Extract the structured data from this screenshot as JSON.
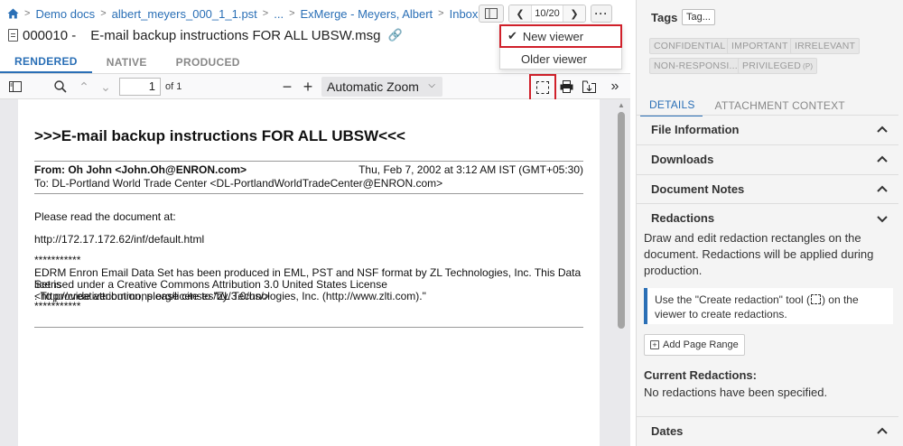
{
  "breadcrumb": {
    "items": [
      "Demo docs",
      "albert_meyers_000_1_1.pst",
      "...",
      "ExMerge - Meyers, Albert",
      "Inbox"
    ]
  },
  "document": {
    "number": "000010 -",
    "title": "E-mail backup instructions FOR ALL UBSW.msg"
  },
  "pager": {
    "count": "10/20"
  },
  "viewer_menu": {
    "options": [
      "New viewer",
      "Older viewer"
    ],
    "selected": "New viewer"
  },
  "view_tabs": [
    "RENDERED",
    "NATIVE",
    "PRODUCED"
  ],
  "viewer_toolbar": {
    "page_value": "1",
    "page_of": "of 1",
    "zoom": "Automatic Zoom"
  },
  "email": {
    "subject": ">>>E-mail backup instructions FOR ALL UBSW<<<",
    "from": "From: Oh John <John.Oh@ENRON.com>",
    "date": "Thu, Feb 7, 2002 at 3:12 AM IST (GMT+05:30)",
    "to": "To: DL-Portland World Trade Center <DL-PortlandWorldTradeCenter@ENRON.com>",
    "line1": "Please read the document at:",
    "line2": "http://172.17.172.62/inf/default.html",
    "stars1": "***********",
    "body1": "EDRM Enron Email Data Set has been produced in EML, PST and NSF format by ZL Technologies, Inc. This Data Set is",
    "body2": "licensed under a Creative Commons Attribution 3.0 United States License <http://creativecommons.org/licenses/by/3.0/us/>",
    "body3": ". To provide attribution, please cite to \"ZL Technologies, Inc. (http://www.zlti.com).\"",
    "stars2": "***********"
  },
  "tags": {
    "heading": "Tags",
    "button": "Tag...",
    "chips": [
      "CONFIDENTIAL",
      "IMPORTANT",
      "IRRELEVANT",
      "NON-RESPONSI...",
      "PRIVILEGED"
    ],
    "privileged_sub": "(P)"
  },
  "detail_tabs": [
    "DETAILS",
    "ATTACHMENT CONTEXT"
  ],
  "sections": {
    "file_info": "File Information",
    "downloads": "Downloads",
    "notes": "Document Notes",
    "redactions": "Redactions",
    "dates": "Dates"
  },
  "redactions": {
    "description": "Draw and edit redaction rectangles on the document. Redactions will be applied during production.",
    "info_pre": "Use the \"Create redaction\" tool (",
    "info_post": ") on the viewer to create redactions.",
    "add_range": "Add Page Range",
    "current_heading": "Current Redactions:",
    "none_text": "No redactions have been specified."
  },
  "colors": {
    "accent": "#2a6fb6",
    "highlight": "#d0202a"
  }
}
